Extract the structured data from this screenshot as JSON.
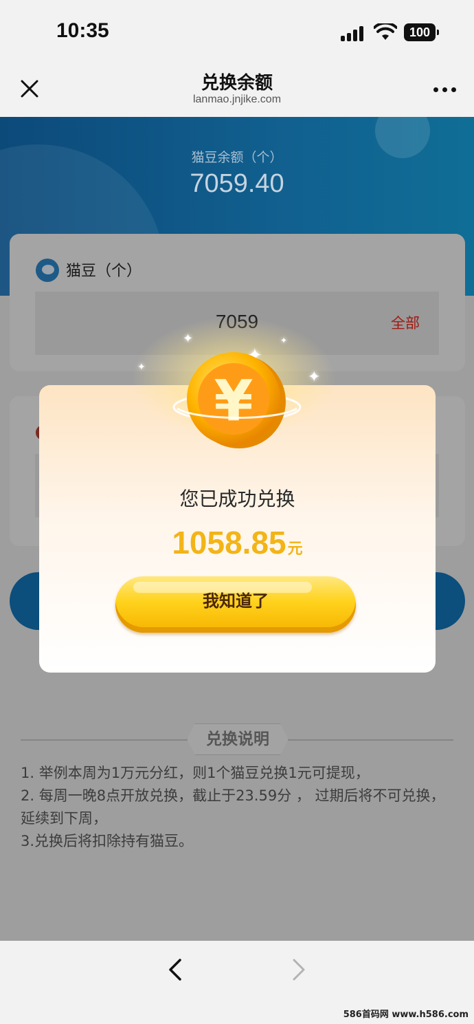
{
  "status_bar": {
    "time": "10:35",
    "battery": "100"
  },
  "nav": {
    "title": "兑换余额",
    "url": "lanmao.jnjike.com"
  },
  "header": {
    "balance_label": "猫豆余额（个）",
    "balance_value": "7059.40"
  },
  "form": {
    "beans_label": "猫豆（个）",
    "amount_value": "7059",
    "all_button": "全部"
  },
  "notes": {
    "title": "兑换说明",
    "lines": [
      "1. 举例本周为1万元分红，则1个猫豆兑换1元可提现，",
      "2. 每周一晚8点开放兑换，截止于23.59分 ， 过期后将不可兑换，延续到下周，",
      "3.兑换后将扣除持有猫豆。"
    ]
  },
  "modal": {
    "message": "您已成功兑换",
    "amount": "1058.85",
    "unit": "元",
    "button": "我知道了",
    "coin_symbol": "¥"
  },
  "watermark": "586首码网 www.h586.com",
  "colors": {
    "gold": "#f2b417",
    "button_text": "#4b2608",
    "header_blue": "#11608f"
  }
}
